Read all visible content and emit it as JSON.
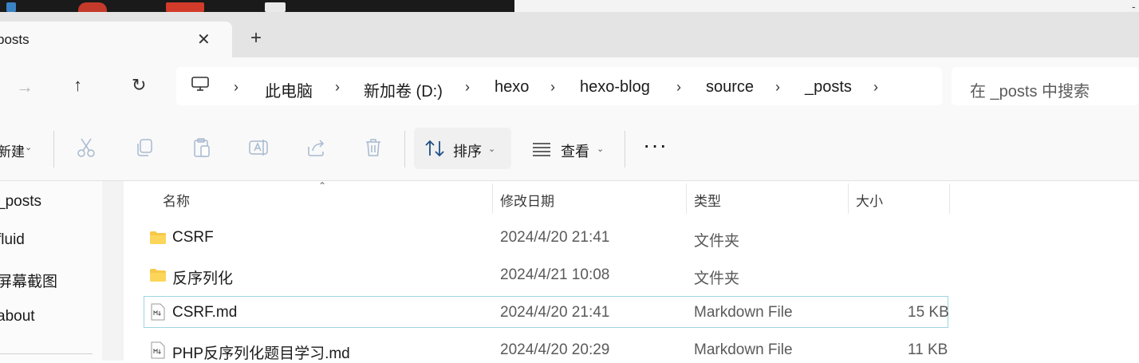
{
  "window": {
    "tab_title": "posts",
    "tab_close_glyph": "✕",
    "new_tab_glyph": "+",
    "corner_glyph": "-"
  },
  "nav": {
    "forward_glyph": "→",
    "up_glyph": "↑",
    "refresh_glyph": "↻",
    "breadcrumb": [
      "此电脑",
      "新加卷 (D:)",
      "hexo",
      "hexo-blog",
      "source",
      "_posts"
    ],
    "separator_glyph": "›",
    "search_placeholder": "在 _posts 中搜索"
  },
  "toolbar": {
    "new_label": "新建",
    "caret_glyph": "⌄",
    "sort_label": "排序",
    "view_label": "查看",
    "more_glyph": "···",
    "icons": [
      "cut-icon",
      "copy-icon",
      "paste-icon",
      "rename-icon",
      "share-icon",
      "delete-icon",
      "sort-icon",
      "view-icon"
    ]
  },
  "sidebar": {
    "items": [
      "_posts",
      "fluid",
      "屏幕截图",
      "about"
    ]
  },
  "columns": {
    "sort_indicator": "⌃",
    "name": "名称",
    "date": "修改日期",
    "type": "类型",
    "size": "大小"
  },
  "files": [
    {
      "name": "CSRF",
      "date": "2024/4/20 21:41",
      "type": "文件夹",
      "size": "",
      "icon": "folder-icon"
    },
    {
      "name": "反序列化",
      "date": "2024/4/21 10:08",
      "type": "文件夹",
      "size": "",
      "icon": "folder-icon"
    },
    {
      "name": "CSRF.md",
      "date": "2024/4/20 21:41",
      "type": "Markdown File",
      "size": "15 KB",
      "icon": "markdown-file-icon",
      "selected": true
    },
    {
      "name": "PHP反序列化题目学习.md",
      "date": "2024/4/20 20:29",
      "type": "Markdown File",
      "size": "11 KB",
      "icon": "markdown-file-icon"
    }
  ],
  "colors": {
    "accent_selection": "#9fd4e3",
    "folder": "#f7c948",
    "disabled_icon": "#a7b9cf"
  }
}
